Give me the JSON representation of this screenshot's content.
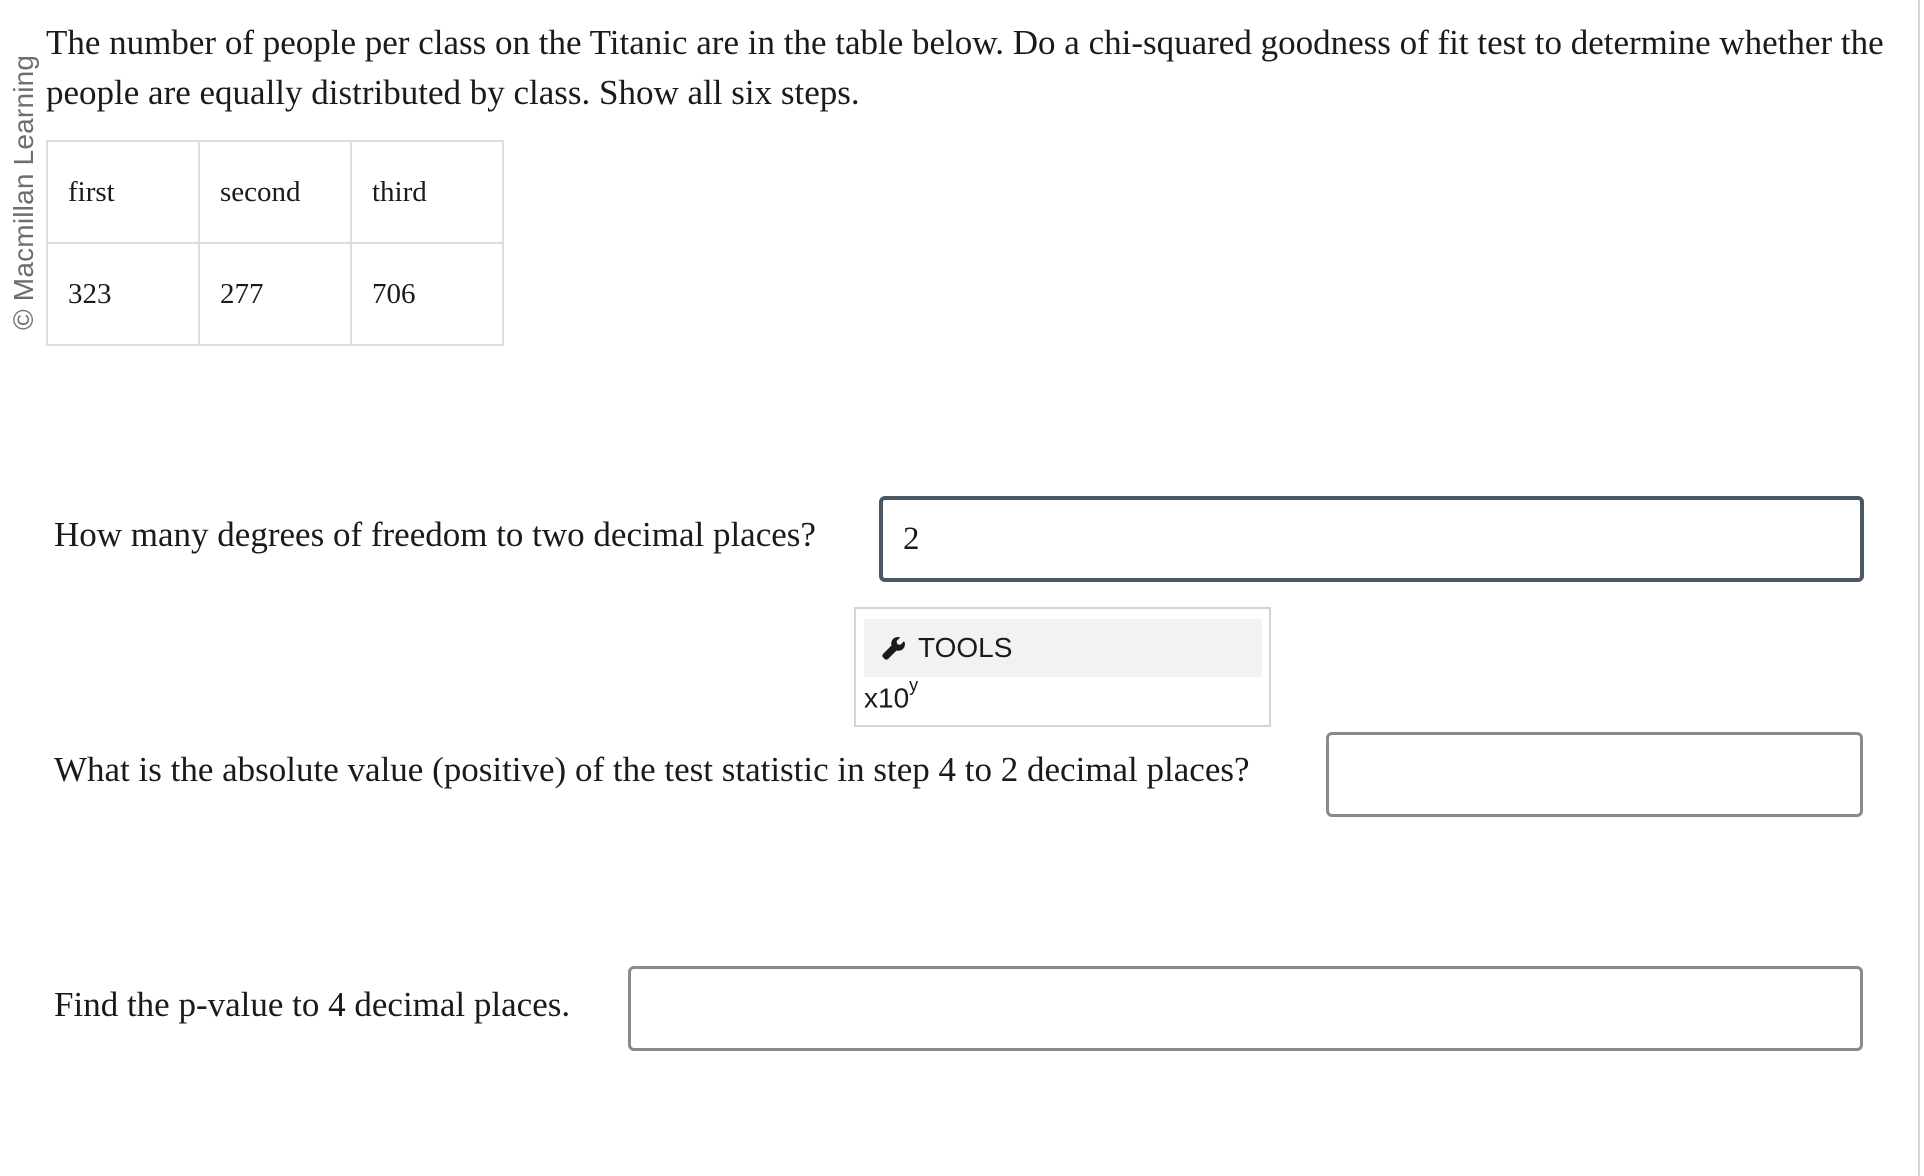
{
  "copyright": "© Macmillan Learning",
  "prompt": "The number of people per class on the Titanic are in the table below. Do a chi-squared goodness of fit test to determine whether the people are equally distributed by class. Show all six steps.",
  "table": {
    "headers": [
      "first",
      "second",
      "third"
    ],
    "values": [
      "323",
      "277",
      "706"
    ]
  },
  "questions": [
    {
      "label": "How many degrees of freedom to two decimal places?",
      "value": "2"
    },
    {
      "label": "What is the absolute value (positive) of the test statistic in step 4 to 2 decimal places?",
      "value": ""
    },
    {
      "label": "Find the p-value to 4 decimal places.",
      "value": ""
    }
  ],
  "tools": {
    "label": "TOOLS",
    "icon": "wrench-icon",
    "sci_base": "x10",
    "sci_exp": "y"
  }
}
